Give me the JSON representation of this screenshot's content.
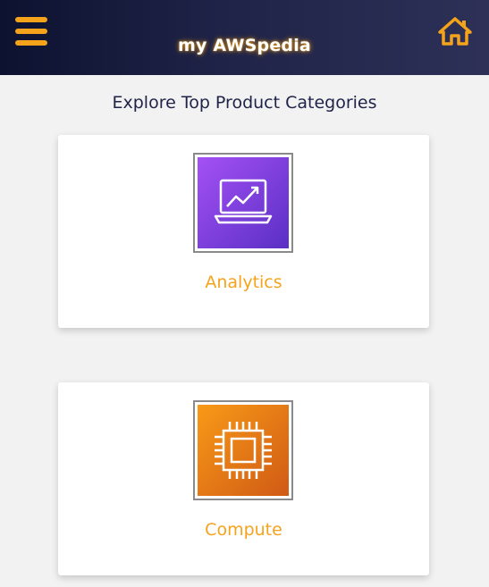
{
  "header": {
    "title": "my AWSpedia",
    "menu_icon": "hamburger-menu-icon",
    "home_icon": "home-icon",
    "accent_color": "#f5a31a"
  },
  "main": {
    "section_title": "Explore Top Product Categories",
    "categories": [
      {
        "label": "Analytics",
        "icon": "analytics-chart-icon",
        "tile_color": "#7b3fe4"
      },
      {
        "label": "Compute",
        "icon": "chip-icon",
        "tile_color": "#e8790f"
      }
    ]
  }
}
